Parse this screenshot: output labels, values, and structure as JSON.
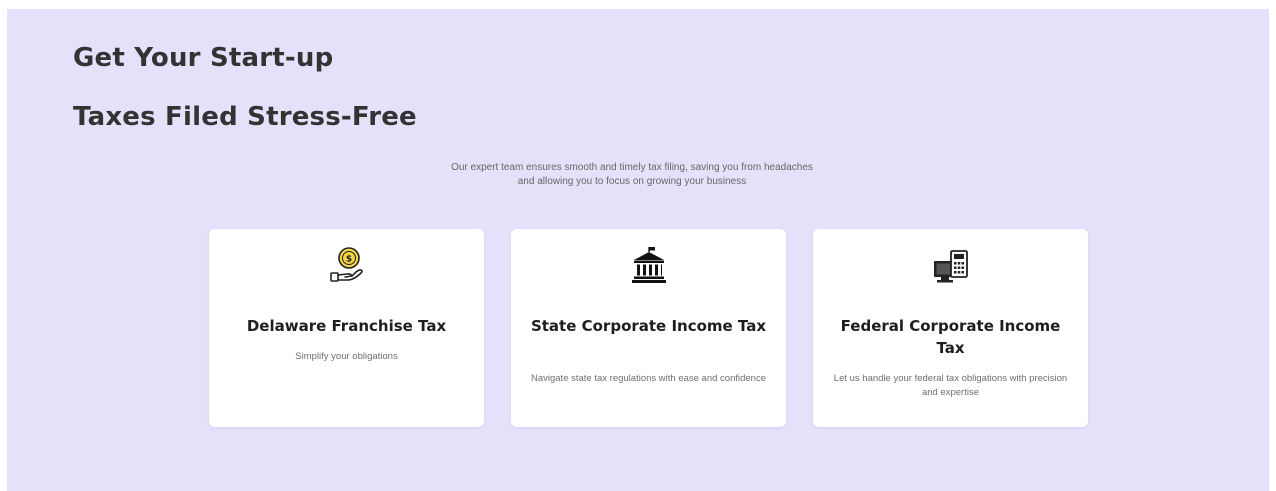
{
  "hero": {
    "title_line1": "Get Your Start-up",
    "title_line2": "Taxes Filed Stress-Free",
    "subtitle_line1": "Our expert team ensures smooth and timely tax filing, saving you from headaches",
    "subtitle_line2": "and allowing you to focus on growing your business"
  },
  "cards": [
    {
      "icon": "coin-hand-icon",
      "title": "Delaware Franchise Tax",
      "description": "Simplify your obligations"
    },
    {
      "icon": "government-building-icon",
      "title": "State Corporate Income Tax",
      "description": "Navigate state tax regulations with ease and confidence"
    },
    {
      "icon": "calculator-computer-icon",
      "title": "Federal Corporate Income Tax",
      "description": "Let us handle your federal tax obligations with precision and expertise"
    }
  ],
  "colors": {
    "background": "#e6e1fb",
    "card": "#ffffff",
    "heading": "#333333",
    "coin": "#f5d547"
  }
}
